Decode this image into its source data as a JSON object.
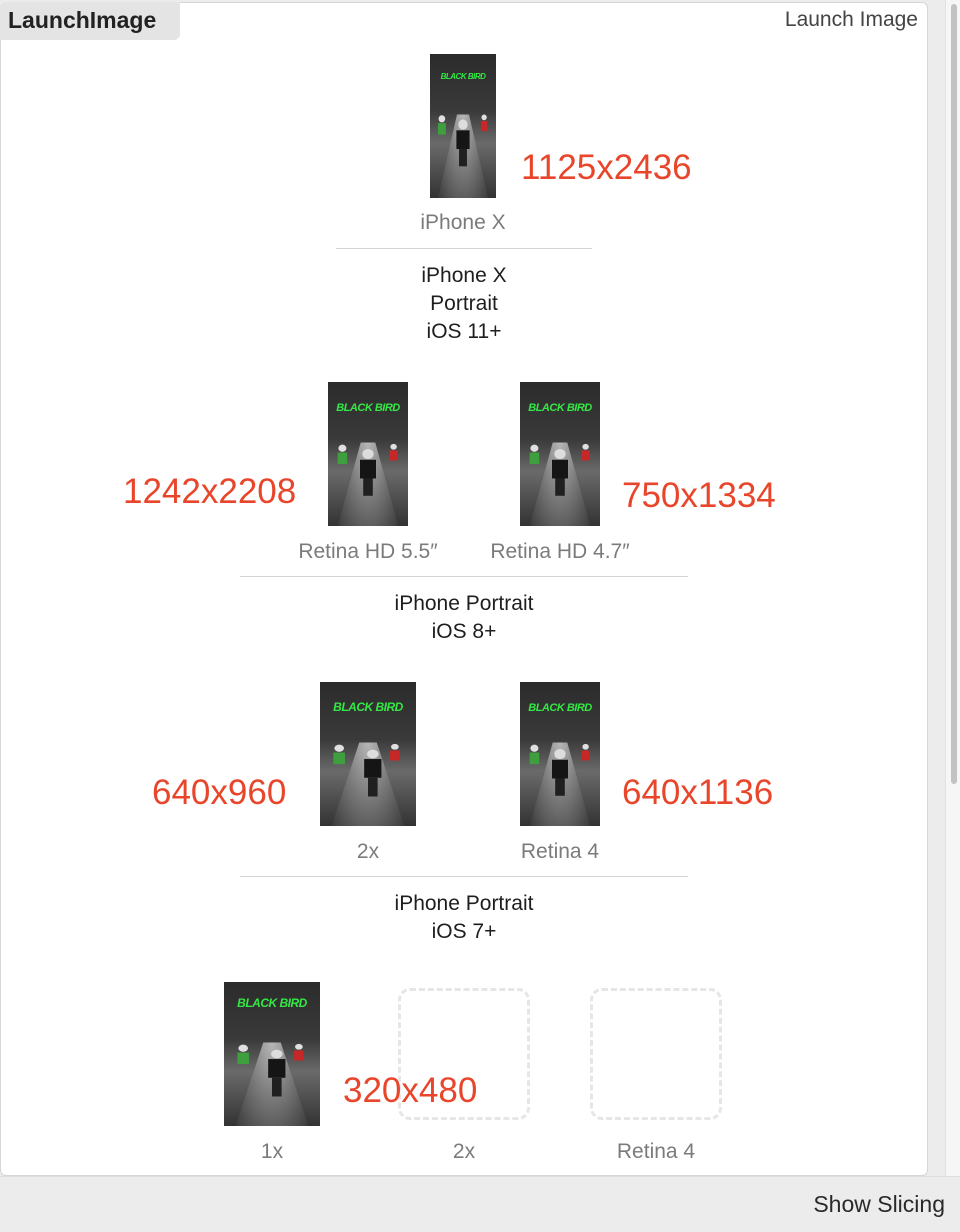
{
  "panel": {
    "group_name": "LaunchImage",
    "set_type": "Launch Image"
  },
  "thumbnail": {
    "brand_text": "BLACK BIRD"
  },
  "sections": [
    {
      "title_lines": [
        "iPhone X",
        "Portrait",
        "iOS 11+"
      ],
      "slots": [
        {
          "caption": "iPhone X",
          "size_label": "1125x2436",
          "filled": true
        }
      ]
    },
    {
      "title_lines": [
        "iPhone Portrait",
        "iOS 8+"
      ],
      "slots": [
        {
          "caption": "Retina HD 5.5″",
          "size_label": "1242x2208",
          "filled": true
        },
        {
          "caption": "Retina HD 4.7″",
          "size_label": "750x1334",
          "filled": true
        }
      ]
    },
    {
      "title_lines": [
        "iPhone Portrait",
        "iOS 7+"
      ],
      "slots": [
        {
          "caption": "2x",
          "size_label": "640x960",
          "filled": true
        },
        {
          "caption": "Retina 4",
          "size_label": "640x1136",
          "filled": true
        }
      ]
    },
    {
      "title_lines": [],
      "slots": [
        {
          "caption": "1x",
          "size_label": "320x480",
          "filled": true
        },
        {
          "caption": "2x",
          "filled": false
        },
        {
          "caption": "Retina 4",
          "filled": false
        }
      ]
    }
  ],
  "footer": {
    "show_slicing_label": "Show Slicing"
  },
  "colors": {
    "size_label": "#e8452a",
    "brand_text": "#33e844"
  }
}
